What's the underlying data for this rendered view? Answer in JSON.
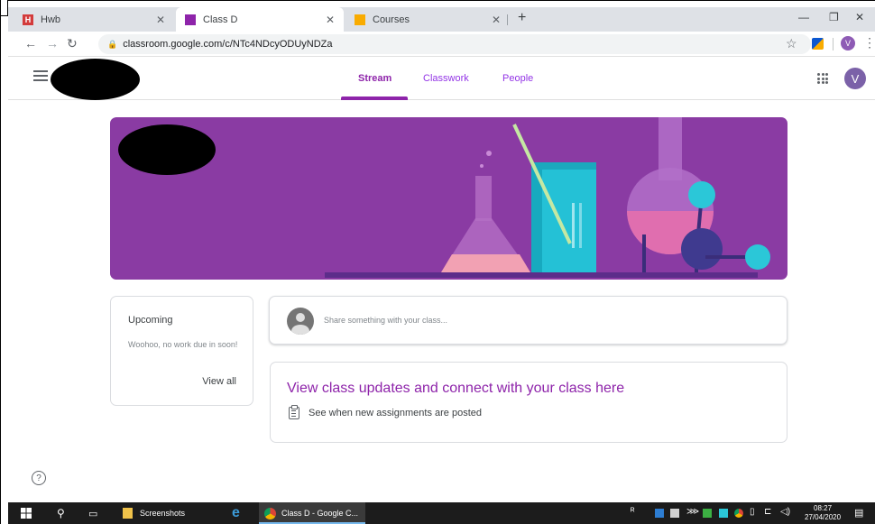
{
  "browser": {
    "tabs": [
      {
        "title": "Hwb",
        "favicon_letter": "H",
        "favicon_color": "#d33b3b",
        "active": false
      },
      {
        "title": "Class D",
        "favicon_letter": "▣",
        "favicon_color": "#8e24aa",
        "active": true
      },
      {
        "title": "Courses",
        "favicon_letter": "▣",
        "favicon_color": "#f9ab00",
        "active": false
      }
    ],
    "new_tab_label": "+",
    "url": "classroom.google.com/c/NTc4NDcyODUyNDZa",
    "profile_letter": "V"
  },
  "app": {
    "nav_tabs": [
      {
        "label": "Stream",
        "active": true
      },
      {
        "label": "Classwork",
        "active": false
      },
      {
        "label": "People",
        "active": false
      }
    ],
    "avatar_letter": "V",
    "accent": "#8e24aa",
    "banner_color": "#8a3ba3"
  },
  "upcoming": {
    "title": "Upcoming",
    "body": "Woohoo, no work due in soon!",
    "link": "View all"
  },
  "share": {
    "placeholder": "Share something with your class..."
  },
  "updates": {
    "title": "View class updates and connect with your class here",
    "row_text": "See when new assignments are posted"
  },
  "help_label": "?",
  "taskbar": {
    "items": [
      {
        "label": "Screenshots"
      },
      {
        "label": "Class D - Google C..."
      }
    ],
    "time": "08:27",
    "date": "27/04/2020"
  }
}
